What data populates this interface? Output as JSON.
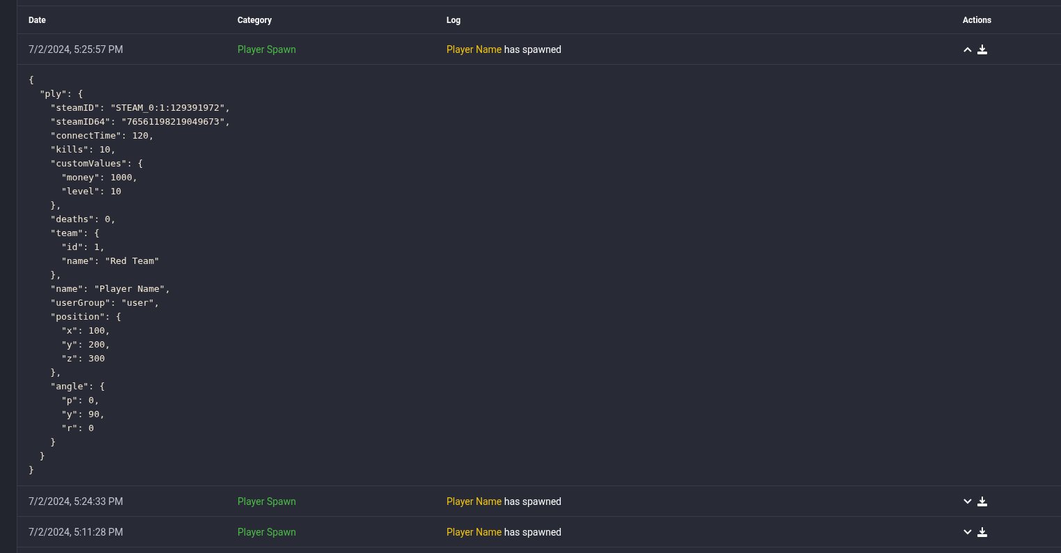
{
  "table": {
    "columns": [
      "Date",
      "Category",
      "Log",
      "Actions"
    ],
    "rows": [
      {
        "date": "7/2/2024, 5:25:57 PM",
        "category": "Player Spawn",
        "player": "Player Name",
        "message": "has spawned",
        "expanded": true,
        "details": "{\n  \"ply\": {\n    \"steamID\": \"STEAM_0:1:129391972\",\n    \"steamID64\": \"76561198219049673\",\n    \"connectTime\": 120,\n    \"kills\": 10,\n    \"customValues\": {\n      \"money\": 1000,\n      \"level\": 10\n    },\n    \"deaths\": 0,\n    \"team\": {\n      \"id\": 1,\n      \"name\": \"Red Team\"\n    },\n    \"name\": \"Player Name\",\n    \"userGroup\": \"user\",\n    \"position\": {\n      \"x\": 100,\n      \"y\": 200,\n      \"z\": 300\n    },\n    \"angle\": {\n      \"p\": 0,\n      \"y\": 90,\n      \"r\": 0\n    }\n  }\n}"
      },
      {
        "date": "7/2/2024, 5:24:33 PM",
        "category": "Player Spawn",
        "player": "Player Name",
        "message": "has spawned",
        "expanded": false
      },
      {
        "date": "7/2/2024, 5:11:28 PM",
        "category": "Player Spawn",
        "player": "Player Name",
        "message": "has spawned",
        "expanded": false
      }
    ]
  }
}
